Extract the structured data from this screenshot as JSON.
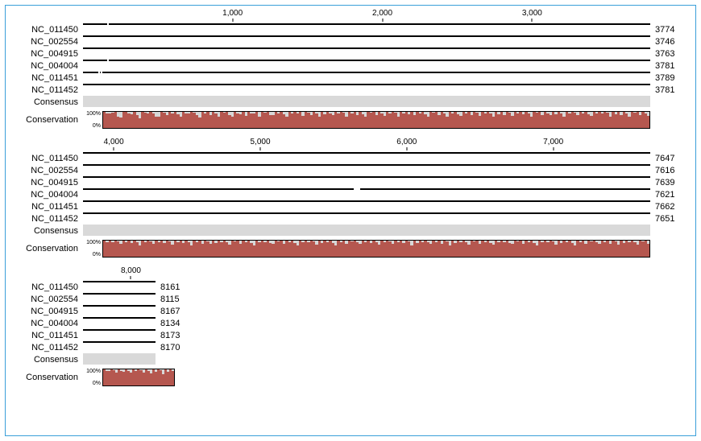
{
  "chart_data": [
    {
      "type": "bar",
      "title": "",
      "xlabel": "",
      "ylabel": "",
      "ylim": [
        0,
        100
      ],
      "x_range": [
        1,
        3789
      ],
      "x_ticks": [
        1000,
        2000,
        3000
      ],
      "sequences": [
        {
          "name": "NC_011450",
          "end": 3774,
          "gaps": [
            [
              160,
              172
            ]
          ]
        },
        {
          "name": "NC_002554",
          "end": 3746,
          "gaps": []
        },
        {
          "name": "NC_004915",
          "end": 3763,
          "gaps": []
        },
        {
          "name": "NC_004004",
          "end": 3781,
          "gaps": [
            [
              160,
              172
            ]
          ]
        },
        {
          "name": "NC_011451",
          "end": 3789,
          "gaps": [
            [
              105,
              112
            ],
            [
              120,
              128
            ]
          ]
        },
        {
          "name": "NC_011452",
          "end": 3781,
          "gaps": []
        }
      ],
      "consensus_label": "Consensus",
      "conservation_label": "Conservation",
      "pct_top": "100%",
      "pct_bot": "0%",
      "conservation": [
        100,
        92,
        88,
        95,
        100,
        70,
        65,
        100,
        98,
        90,
        85,
        100,
        80,
        60,
        100,
        95,
        90,
        100,
        88,
        72,
        68,
        100,
        95,
        80,
        100,
        90,
        100,
        85,
        70,
        100,
        92,
        88,
        100,
        95,
        78,
        65,
        100,
        90,
        100,
        82,
        100,
        88,
        72,
        100,
        95,
        100,
        80,
        68,
        100,
        90,
        85,
        100,
        76,
        100,
        92,
        88,
        100,
        70,
        100,
        95,
        100,
        82,
        78,
        100,
        90,
        100,
        85,
        68,
        100,
        92,
        100,
        88,
        100,
        75,
        100,
        95,
        80,
        100,
        90,
        70,
        100,
        85,
        100,
        92,
        78,
        100,
        88,
        100,
        95,
        72,
        100,
        90,
        100,
        82,
        100,
        86,
        68,
        100,
        94,
        100,
        80,
        100,
        90,
        76,
        100,
        88,
        100,
        95,
        70,
        100,
        92,
        100,
        84,
        100,
        78,
        100,
        90,
        100,
        86,
        72,
        100,
        94,
        100,
        80,
        100,
        88,
        68,
        100,
        92,
        100,
        85,
        76,
        100,
        90,
        100,
        82,
        100,
        95,
        74,
        100,
        88,
        100,
        92,
        70,
        100,
        86,
        100,
        80,
        100,
        94,
        76,
        100,
        90,
        100,
        84,
        100,
        88,
        72,
        100,
        95,
        100,
        82,
        100,
        90,
        78,
        100,
        86,
        100,
        92,
        70,
        100,
        88,
        100,
        94,
        80,
        100,
        90,
        100,
        84,
        76,
        100,
        92,
        100,
        88,
        100,
        95,
        72,
        100,
        86,
        100,
        80,
        100,
        90,
        68,
        100,
        94,
        100,
        82,
        100,
        88,
        76
      ]
    },
    {
      "type": "bar",
      "title": "",
      "xlabel": "",
      "ylabel": "",
      "ylim": [
        0,
        100
      ],
      "x_range": [
        3790,
        7662
      ],
      "x_ticks": [
        4000,
        5000,
        6000,
        7000
      ],
      "sequences": [
        {
          "name": "NC_011450",
          "end": 7647,
          "gaps": []
        },
        {
          "name": "NC_002554",
          "end": 7616,
          "gaps": []
        },
        {
          "name": "NC_004915",
          "end": 7639,
          "gaps": []
        },
        {
          "name": "NC_004004",
          "end": 7621,
          "gaps": [
            [
              5640,
              5680
            ]
          ]
        },
        {
          "name": "NC_011451",
          "end": 7662,
          "gaps": []
        },
        {
          "name": "NC_011452",
          "end": 7651,
          "gaps": []
        }
      ],
      "consensus_label": "Consensus",
      "conservation_label": "Conservation",
      "pct_top": "100%",
      "pct_bot": "0%",
      "conservation": [
        100,
        92,
        100,
        88,
        100,
        95,
        78,
        100,
        90,
        100,
        85,
        100,
        92,
        72,
        100,
        88,
        100,
        94,
        80,
        100,
        90,
        100,
        86,
        100,
        95,
        76,
        100,
        92,
        100,
        84,
        100,
        88,
        70,
        100,
        90,
        100,
        82,
        100,
        94,
        78,
        100,
        86,
        100,
        92,
        100,
        88,
        74,
        100,
        95,
        100,
        80,
        100,
        90,
        100,
        84,
        72,
        100,
        92,
        100,
        88,
        100,
        86,
        78,
        100,
        94,
        100,
        82,
        100,
        90,
        100,
        85,
        70,
        100,
        92,
        100,
        88,
        100,
        95,
        76,
        100,
        84,
        100,
        90,
        100,
        86,
        72,
        100,
        92,
        100,
        80,
        100,
        94,
        100,
        88,
        78,
        100,
        90,
        100,
        85,
        100,
        92,
        74,
        100,
        88,
        100,
        94,
        80,
        100,
        90,
        100,
        86,
        100,
        95,
        72,
        100,
        84,
        100,
        92,
        100,
        88,
        78,
        100,
        90,
        100,
        82,
        100,
        94,
        70,
        100,
        86,
        100,
        92,
        100,
        88,
        76,
        100,
        95,
        100,
        80,
        100,
        90,
        100,
        84,
        74,
        100,
        92,
        100,
        88,
        100,
        86,
        78,
        100,
        94,
        100,
        82,
        100,
        90,
        100,
        85,
        72,
        100,
        92,
        100,
        88,
        100,
        95,
        76,
        100,
        84,
        100,
        90,
        100,
        86,
        70,
        100,
        92,
        100,
        80,
        100,
        94,
        100,
        88,
        78,
        100,
        90,
        100,
        82,
        100,
        95,
        74,
        100,
        86,
        100,
        92,
        100,
        88,
        76,
        100,
        94,
        100,
        80
      ]
    },
    {
      "type": "bar",
      "title": "",
      "xlabel": "",
      "ylabel": "",
      "ylim": [
        0,
        100
      ],
      "x_range": [
        7663,
        8173
      ],
      "x_ticks": [
        8000
      ],
      "sequences": [
        {
          "name": "NC_011450",
          "end": 8161,
          "gaps": []
        },
        {
          "name": "NC_002554",
          "end": 8115,
          "gaps": []
        },
        {
          "name": "NC_004915",
          "end": 8167,
          "gaps": []
        },
        {
          "name": "NC_004004",
          "end": 8134,
          "gaps": []
        },
        {
          "name": "NC_011451",
          "end": 8173,
          "gaps": []
        },
        {
          "name": "NC_011452",
          "end": 8170,
          "gaps": []
        }
      ],
      "consensus_label": "Consensus",
      "conservation_label": "Conservation",
      "pct_top": "100%",
      "pct_bot": "0%",
      "conservation": [
        100,
        92,
        88,
        100,
        95,
        80,
        100,
        90,
        85,
        100,
        92,
        78,
        100,
        88,
        100,
        94,
        82,
        100,
        90,
        76,
        100,
        86,
        100,
        95,
        72,
        100,
        84,
        100,
        90
      ]
    }
  ]
}
